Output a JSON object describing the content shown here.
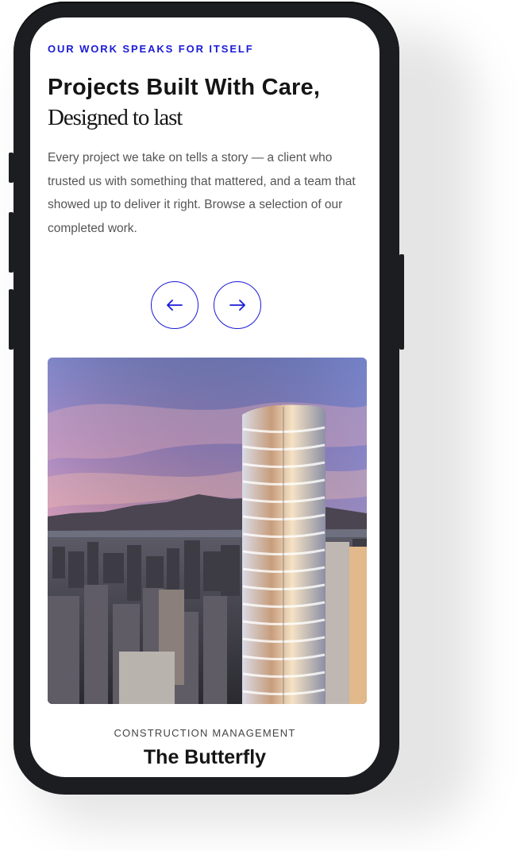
{
  "section": {
    "eyebrow": "OUR WORK SPEAKS FOR ITSELF",
    "title": "Projects Built With Care,",
    "subtitle": "Designed to last",
    "description": "Every project we take on tells a story — a client who trusted  us with something that mattered, and a team that showed up to  deliver it right. Browse a selection of our completed work."
  },
  "carousel": {
    "prev_icon": "arrow-left-icon",
    "next_icon": "arrow-right-icon"
  },
  "project": {
    "category": "CONSTRUCTION MANAGEMENT",
    "name": "The Butterfly"
  },
  "colors": {
    "accent": "#1b1bd6",
    "text": "#151515",
    "body_text": "#555555",
    "device": "#1c1d21"
  }
}
